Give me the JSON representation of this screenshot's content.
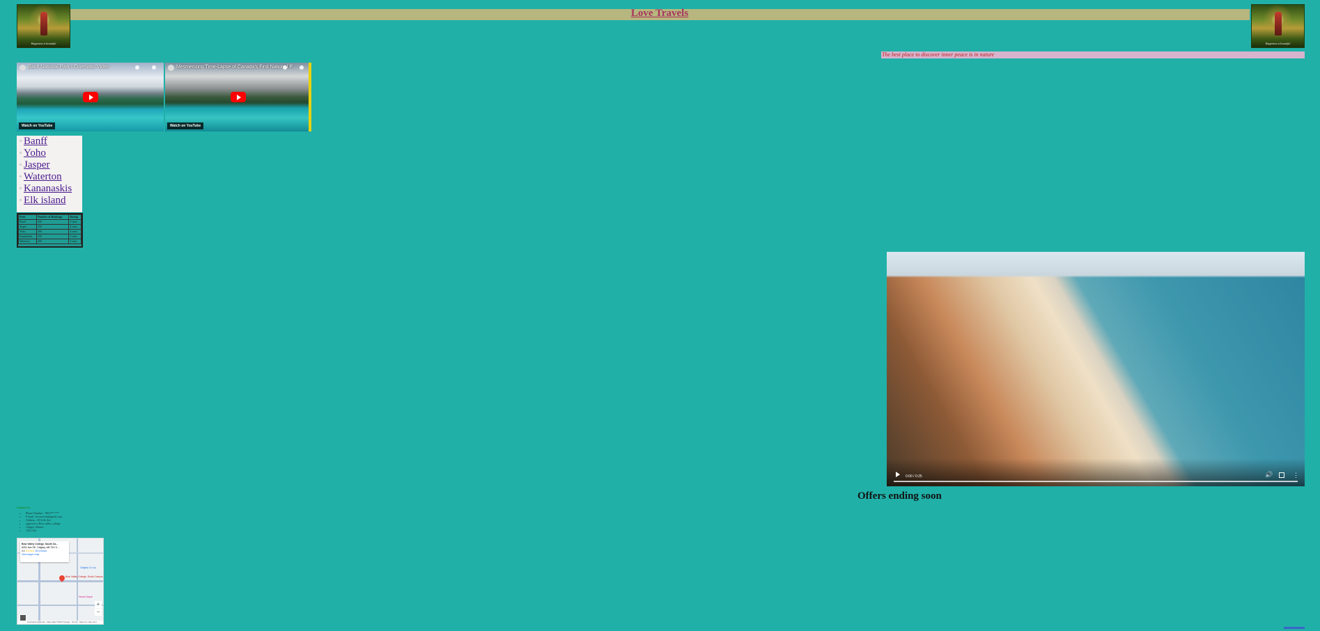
{
  "header": {
    "title": "Love Travels",
    "logo_caption": "Happiness is beautiful",
    "tagline": "The best place to discover inner peace is in nature"
  },
  "colors": {
    "page_background": "#20b0a8",
    "header_bar": "#b7b67e",
    "title_text": "#a8335f",
    "tagline_bar": "#d6b4cd",
    "tagline_text": "#c21a1a",
    "link_text": "#4b1a8e"
  },
  "youtube": [
    {
      "title": "Banff National Park | Cinematic Video",
      "watch_label": "Watch on YouTube"
    },
    {
      "title": "Mesmerizing Time-Lapse of Canada's First National P...",
      "watch_label": "Watch on YouTube"
    }
  ],
  "parks": [
    {
      "label": "Banff"
    },
    {
      "label": "Yoho"
    },
    {
      "label": "Jasper"
    },
    {
      "label": "Waterton"
    },
    {
      "label": "Kananaskis"
    },
    {
      "label": "Elk island"
    }
  ],
  "ranking_table": {
    "headers": [
      "Park",
      "Number of Bookings",
      "Rating"
    ],
    "rows": [
      [
        "Banff",
        "450",
        "5 stars"
      ],
      [
        "Jasper",
        "350",
        "4 stars"
      ],
      [
        "Yoho",
        "300",
        "4 stars"
      ],
      [
        "Kananaskis",
        "250",
        "3 stars"
      ],
      [
        "Waterton",
        "200",
        "3 stars"
      ]
    ]
  },
  "video": {
    "time": "0:00 / 0:25",
    "icons": [
      "play-icon",
      "volume-icon",
      "fullscreen-icon",
      "more-options-icon"
    ]
  },
  "offers": {
    "heading": "Offers ending soon"
  },
  "contact": {
    "heading": "Contact Us",
    "items": [
      "Phone Number : 780-9**-***",
      "E-mail : lovetravels@gmail.com",
      "Address : 50 St & Ave",
      "opposite to Bow valley college",
      "Calgary Alberta",
      "T2G 0A4"
    ]
  },
  "map": {
    "card_title": "Bow Valley College, South Ca...",
    "card_address": "6001 Ave SE, Calgary, AB T2H 0...",
    "card_rating": "4.1",
    "card_reviews": "38 reviews",
    "card_link": "View larger map",
    "place_label": "Bow Valley College, South Campus",
    "labels": [
      "Calgary Co-op",
      "Home Depot"
    ],
    "zoom_in": "+",
    "zoom_out": "−",
    "footer": "Keyboard shortcuts · Map data ©2024 Google · Terms · Report a map error"
  }
}
